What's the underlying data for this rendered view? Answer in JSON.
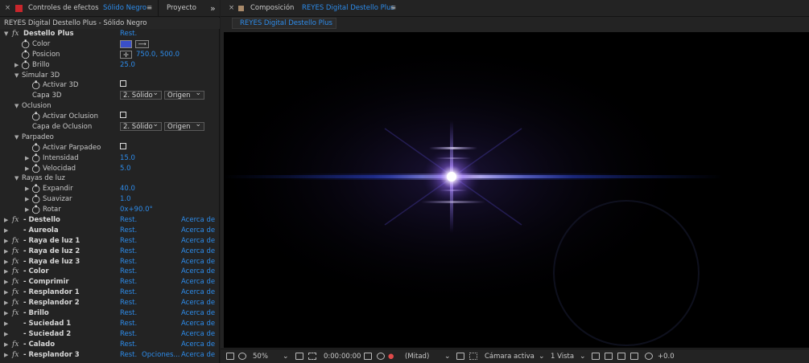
{
  "left_tabs": {
    "close_x": "×",
    "panel_title": "Controles de efectos",
    "layer_name": "Sólido Negro",
    "menu_glyph": "≡",
    "project_tab": "Proyecto",
    "overflow_glyph": "»"
  },
  "subheader": "REYES Digital Destello Plus - Sólido Negro",
  "effect": {
    "name": "Destello Plus",
    "reset": "Rest.",
    "color_label": "Color",
    "color_value": "#3a4fc9",
    "position_label": "Posicion",
    "position_value": "750.0, 500.0",
    "brightness_label": "Brillo",
    "brightness_value": "25.0",
    "sim3d_label": "Simular 3D",
    "activate3d_label": "Activar 3D",
    "layer3d_label": "Capa 3D",
    "layer3d_value": "2. Sólido",
    "layer3d_origin": "Origen",
    "occlusion_label": "Oclusion",
    "activate_occ_label": "Activar Oclusion",
    "occ_layer_label": "Capa de Oclusion",
    "occ_layer_value": "2. Sólido",
    "occ_origin": "Origen",
    "flicker_label": "Parpadeo",
    "activate_flicker_label": "Activar Parpadeo",
    "intensity_label": "Intensidad",
    "intensity_value": "15.0",
    "speed_label": "Velocidad",
    "speed_value": "5.0",
    "rays_label": "Rayas de luz",
    "expand_label": "Expandir",
    "expand_value": "40.0",
    "soften_label": "Suavizar",
    "soften_value": "1.0",
    "rotate_label": "Rotar",
    "rotate_value": "0x+90.0°"
  },
  "effects_list": [
    {
      "name": "- Destello",
      "reset": "Rest.",
      "about": "Acerca de"
    },
    {
      "name": "- Aureola",
      "reset": "Rest.",
      "about": "Acerca de"
    },
    {
      "name": "- Raya de luz 1",
      "reset": "Rest.",
      "about": "Acerca de"
    },
    {
      "name": "- Raya de luz 2",
      "reset": "Rest.",
      "about": "Acerca de"
    },
    {
      "name": "- Raya de luz 3",
      "reset": "Rest.",
      "about": "Acerca de"
    },
    {
      "name": "- Color",
      "reset": "Rest.",
      "about": "Acerca de"
    },
    {
      "name": "- Comprimir",
      "reset": "Rest.",
      "about": "Acerca de"
    },
    {
      "name": "- Resplandor 1",
      "reset": "Rest.",
      "about": "Acerca de"
    },
    {
      "name": "- Resplandor 2",
      "reset": "Rest.",
      "about": "Acerca de"
    },
    {
      "name": "- Brillo",
      "reset": "Rest.",
      "about": "Acerca de"
    },
    {
      "name": "- Suciedad 1",
      "reset": "Rest.",
      "about": "Acerca de"
    },
    {
      "name": "- Suciedad 2",
      "reset": "Rest.",
      "about": "Acerca de"
    },
    {
      "name": "- Calado",
      "reset": "Rest.",
      "about": "Acerca de"
    },
    {
      "name": "- Resplandor 3",
      "reset": "Rest.",
      "options": "Opciones...",
      "about": "Acerca de"
    }
  ],
  "right_tabs": {
    "close_x": "×",
    "panel_title": "Composición",
    "comp_name": "REYES Digital Destello Plus",
    "menu_glyph": "≡",
    "viewer_tab": "REYES Digital Destello Plus"
  },
  "bottom_bar": {
    "zoom": "50%",
    "timecode": "0:00:00:00",
    "resolution": "(Mitad)",
    "camera": "Cámara activa",
    "views": "1 Vista",
    "exposure": "+0.0"
  },
  "colors": {
    "accent": "#2d8ceb",
    "flare_core": "#ffffff",
    "flare_glow": "#8a5cff"
  }
}
